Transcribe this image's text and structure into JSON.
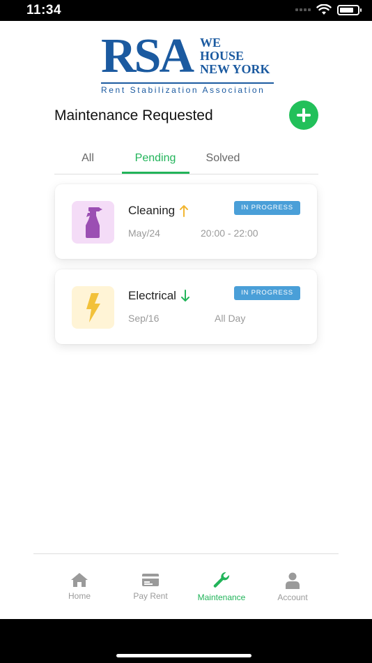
{
  "status_bar": {
    "time": "11:34",
    "battery_level": 0.8
  },
  "logo": {
    "rsa": "RSA",
    "line1": "WE",
    "line2": "HOUSE",
    "line3": "NEW YORK",
    "subtitle": "Rent Stabilization Association"
  },
  "header": {
    "title": "Maintenance Requested"
  },
  "tabs": [
    {
      "label": "All",
      "active": false
    },
    {
      "label": "Pending",
      "active": true
    },
    {
      "label": "Solved",
      "active": false
    }
  ],
  "requests": [
    {
      "title": "Cleaning",
      "priority": "up",
      "status": "IN PROGRESS",
      "date": "May/24",
      "time": "20:00 - 22:00",
      "icon": "spray-bottle-icon",
      "icon_bg": "#f4dcf7",
      "icon_color": "#9b4fb3",
      "priority_color": "#f2b632"
    },
    {
      "title": "Electrical",
      "priority": "down",
      "status": "IN PROGRESS",
      "date": "Sep/16",
      "time": "All Day",
      "icon": "lightning-icon",
      "icon_bg": "#fff4d6",
      "icon_color": "#f2c13a",
      "priority_color": "#22b45a"
    }
  ],
  "bottom_nav": [
    {
      "label": "Home",
      "icon": "home-icon",
      "active": false
    },
    {
      "label": "Pay Rent",
      "icon": "card-icon",
      "active": false
    },
    {
      "label": "Maintenance",
      "icon": "wrench-icon",
      "active": true
    },
    {
      "label": "Account",
      "icon": "person-icon",
      "active": false
    }
  ],
  "colors": {
    "accent": "#22b45a",
    "brand": "#1b5aa0",
    "badge": "#4a9fd8"
  }
}
